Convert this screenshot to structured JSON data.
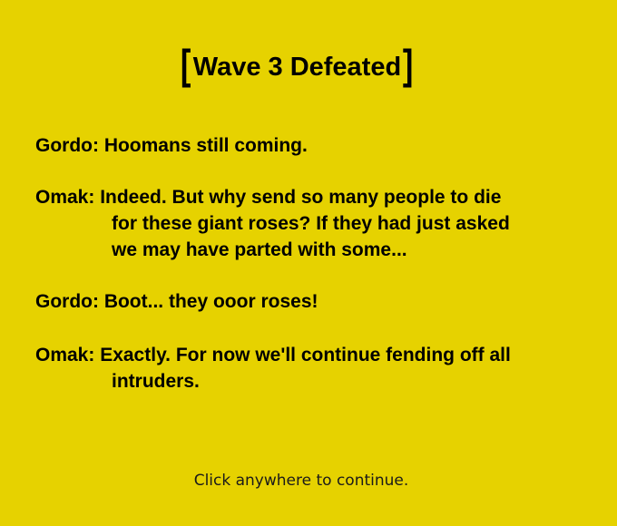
{
  "title": {
    "open_bracket": "[",
    "text": "Wave 3 Defeated",
    "close_bracket": "]"
  },
  "dialogue": [
    {
      "speaker": "Gordo",
      "lines": [
        "Gordo: Hoomans still coming."
      ]
    },
    {
      "speaker": "Omak",
      "lines": [
        "Omak: Indeed. But why send so many people to die",
        "for these giant roses? If they had just asked",
        "we may have parted with some..."
      ]
    },
    {
      "speaker": "Gordo",
      "lines": [
        "Gordo: Boot... they ooor roses!"
      ]
    },
    {
      "speaker": "Omak",
      "lines": [
        "Omak: Exactly. For now we'll continue fending off all",
        "intruders."
      ]
    }
  ],
  "footer": {
    "prompt": "Click anywhere to continue."
  },
  "colors": {
    "background": "#e6d200",
    "text": "#000000"
  }
}
